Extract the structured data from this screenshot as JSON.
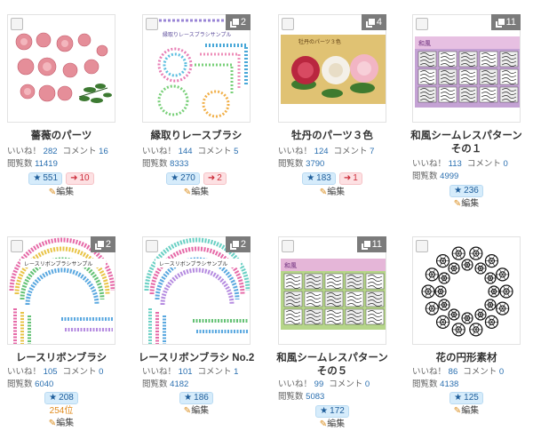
{
  "labels": {
    "like": "いいね！",
    "comment": "コメント",
    "views": "閲覧数",
    "edit": "編集"
  },
  "icons": {
    "star": "star-icon",
    "share": "arrow-share-icon",
    "edit": "pencil-icon",
    "images": "images-count-icon",
    "checkbox": "checkbox"
  },
  "colors": {
    "link": "#2a6fb0",
    "star_bg": "#d6ecfb",
    "share_bg": "#fde1e3",
    "rank": "#e08a1b",
    "badge": "#7b7b7b"
  },
  "cards": [
    {
      "title": "薔薇のパーツ",
      "likes": "282",
      "comments": "16",
      "views": "11419",
      "stars": "551",
      "shares": "10",
      "count": ""
    },
    {
      "title": "縁取りレースブラシ",
      "likes": "144",
      "comments": "5",
      "views": "8333",
      "stars": "270",
      "shares": "2",
      "count": "2",
      "thumb_text": "縁取りレースブラシサンプル"
    },
    {
      "title": "牡丹のパーツ３色",
      "likes": "124",
      "comments": "7",
      "views": "3790",
      "stars": "183",
      "shares": "1",
      "count": "4",
      "thumb_text": "牡丹のパーツ３色"
    },
    {
      "title": "和風シームレスパターン　その１",
      "likes": "113",
      "comments": "0",
      "views": "4999",
      "stars": "236",
      "count": "11",
      "thumb_text": "和風"
    },
    {
      "title": "レースリボンブラシ",
      "likes": "105",
      "comments": "0",
      "views": "6040",
      "stars": "208",
      "rank": "254位",
      "count": "2",
      "thumb_text": "レースリボンブラシサンプル"
    },
    {
      "title": "レースリボンブラシ No.2",
      "likes": "101",
      "comments": "1",
      "views": "4182",
      "stars": "186",
      "count": "2",
      "thumb_text": "レースリボンブラシサンプル"
    },
    {
      "title": "和風シームレスパターン　その５",
      "likes": "99",
      "comments": "0",
      "views": "5083",
      "stars": "172",
      "count": "11",
      "thumb_text": "和風"
    },
    {
      "title": "花の円形素材",
      "likes": "86",
      "comments": "0",
      "views": "4138",
      "stars": "125",
      "count": ""
    }
  ]
}
